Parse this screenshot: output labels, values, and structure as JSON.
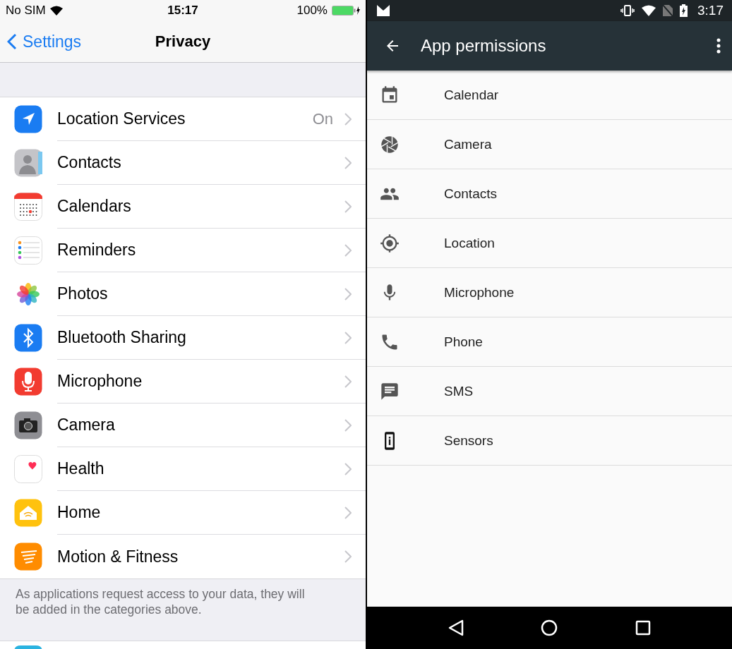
{
  "ios": {
    "status_bar": {
      "carrier": "No SIM",
      "time": "15:17",
      "battery": "100%"
    },
    "nav": {
      "back": "Settings",
      "title": "Privacy"
    },
    "items": [
      {
        "kind": "location",
        "label": "Location Services",
        "value": "On"
      },
      {
        "kind": "contacts",
        "label": "Contacts"
      },
      {
        "kind": "calendars",
        "label": "Calendars"
      },
      {
        "kind": "reminders",
        "label": "Reminders"
      },
      {
        "kind": "photos",
        "label": "Photos"
      },
      {
        "kind": "bluetooth",
        "label": "Bluetooth Sharing"
      },
      {
        "kind": "microphone",
        "label": "Microphone"
      },
      {
        "kind": "camera",
        "label": "Camera"
      },
      {
        "kind": "health",
        "label": "Health"
      },
      {
        "kind": "home",
        "label": "Home"
      },
      {
        "kind": "motion",
        "label": "Motion & Fitness"
      }
    ],
    "footer": "As applications request access to your data, they will be added in the categories above."
  },
  "android": {
    "status_bar": {
      "time": "3:17"
    },
    "toolbar": {
      "title": "App permissions"
    },
    "items": [
      {
        "kind": "calendar",
        "label": "Calendar"
      },
      {
        "kind": "camera",
        "label": "Camera"
      },
      {
        "kind": "contacts",
        "label": "Contacts"
      },
      {
        "kind": "location",
        "label": "Location"
      },
      {
        "kind": "microphone",
        "label": "Microphone"
      },
      {
        "kind": "phone",
        "label": "Phone"
      },
      {
        "kind": "sms",
        "label": "SMS"
      },
      {
        "kind": "sensors",
        "label": "Sensors"
      }
    ]
  }
}
